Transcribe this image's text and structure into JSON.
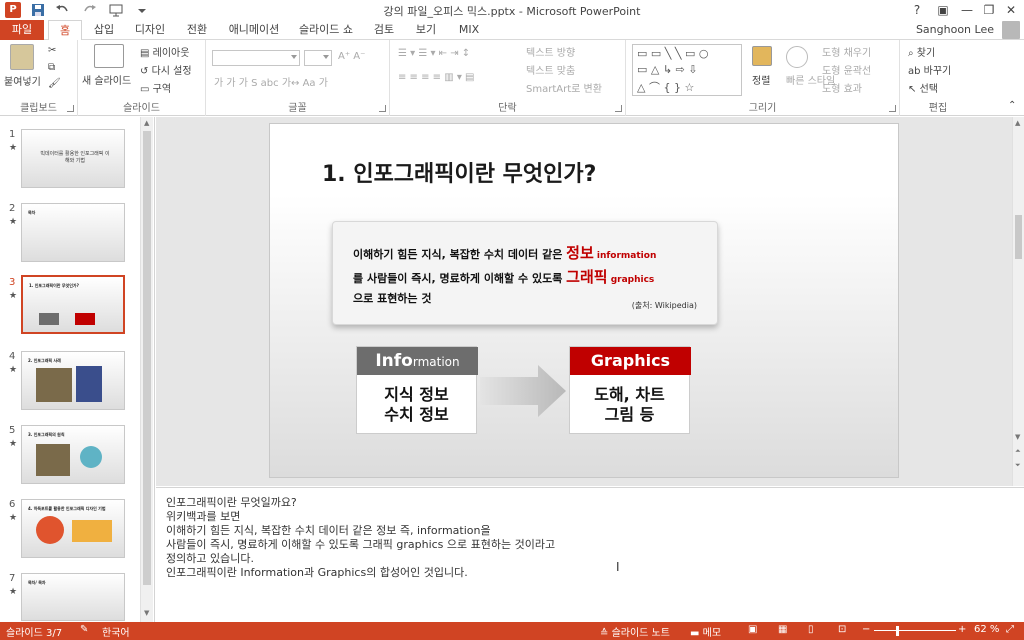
{
  "window": {
    "title": "강의 파일_오피스 믹스.pptx - Microsoft PowerPoint",
    "app_icon": "P",
    "help": "?",
    "min": "—",
    "restore": "❐",
    "close": "✕"
  },
  "tabs": [
    "파일",
    "홈",
    "삽입",
    "디자인",
    "전환",
    "애니메이션",
    "슬라이드 쇼",
    "검토",
    "보기",
    "MIX"
  ],
  "user": "Sanghoon Lee",
  "ribbon": {
    "clipboard": {
      "paste": "붙여넣기",
      "label": "클립보드"
    },
    "slides": {
      "new_slide": "새 슬라이드",
      "layout": "레이아웃",
      "reset": "다시 설정",
      "section": "구역",
      "label": "슬라이드"
    },
    "font": {
      "label": "글꼴",
      "row2": "가  가  가  S  abc  가↔  Aa  가",
      "size": ""
    },
    "paragraph": {
      "text_direction": "텍스트 방향",
      "align_text": "텍스트 맞춤",
      "smartart": "SmartArt로 변환",
      "label": "단락"
    },
    "drawing": {
      "arrange": "정렬",
      "quick_styles": "빠른 스타일",
      "fill": "도형 채우기",
      "outline": "도형 윤곽선",
      "effects": "도형 효과",
      "label": "그리기"
    },
    "editing": {
      "find": "찾기",
      "replace": "바꾸기",
      "select": "선택",
      "label": "편집"
    }
  },
  "thumbnails": [
    {
      "num": "1",
      "star": "★",
      "title": "",
      "content": "빅데이터를 활용한 인포그래픽 이해와 기법"
    },
    {
      "num": "2",
      "star": "★",
      "title": "목차",
      "content": ""
    },
    {
      "num": "3",
      "star": "★",
      "title": "1. 인포그래픽이란 무엇인가?",
      "content": ""
    },
    {
      "num": "4",
      "star": "★",
      "title": "2. 인포그래픽 사례",
      "content": ""
    },
    {
      "num": "5",
      "star": "★",
      "title": "3. 인포그래픽의 원칙",
      "content": ""
    },
    {
      "num": "6",
      "star": "★",
      "title": "4. 하둑포트를 활용한 인포그래픽 디자인 기법",
      "content": ""
    },
    {
      "num": "7",
      "star": "★",
      "title": "목차/ 목차",
      "content": ""
    }
  ],
  "slide": {
    "title": "1. 인포그래픽이란 무엇인가?",
    "line1_a": "이해하기 힘든 지식, 복잡한 수치 데이터 같은 ",
    "line1_red": "정보",
    "line1_small": " information",
    "line2_a": "를 사람들이 즉시, 명료하게 이해할 수 있도록 ",
    "line2_red": "그래픽",
    "line2_small": " graphics",
    "line3": "으로 표현하는 것",
    "source": "(출처: Wikipedia)",
    "info_big": "Info",
    "info_small": "rmation",
    "info_body1": "지식 정보",
    "info_body2": "수치 정보",
    "gfx_head": "Graphics",
    "gfx_body1": "도해, 차트",
    "gfx_body2": "그림 등"
  },
  "notes": [
    "인포그래픽이란 무엇일까요?",
    "위키백과를 보면",
    "이해하기 힘든 지식, 복잡한 수치 데이터 같은 정보 즉, information을",
    "사람들이 즉시, 명료하게 이해할 수 있도록 그래픽 graphics 으로 표현하는 것이라고",
    "정의하고 있습니다.",
    "인포그래픽이란 Information과 Graphics의 합성어인 것입니다."
  ],
  "status": {
    "slide_count": "슬라이드 3/7",
    "language": "한국어",
    "notes_btn": "슬라이드 노트",
    "comments_btn": "메모",
    "zoom": "62 %"
  },
  "colors": {
    "accent": "#d04423",
    "red": "#c00000",
    "gray_header": "#6d6d6d"
  }
}
